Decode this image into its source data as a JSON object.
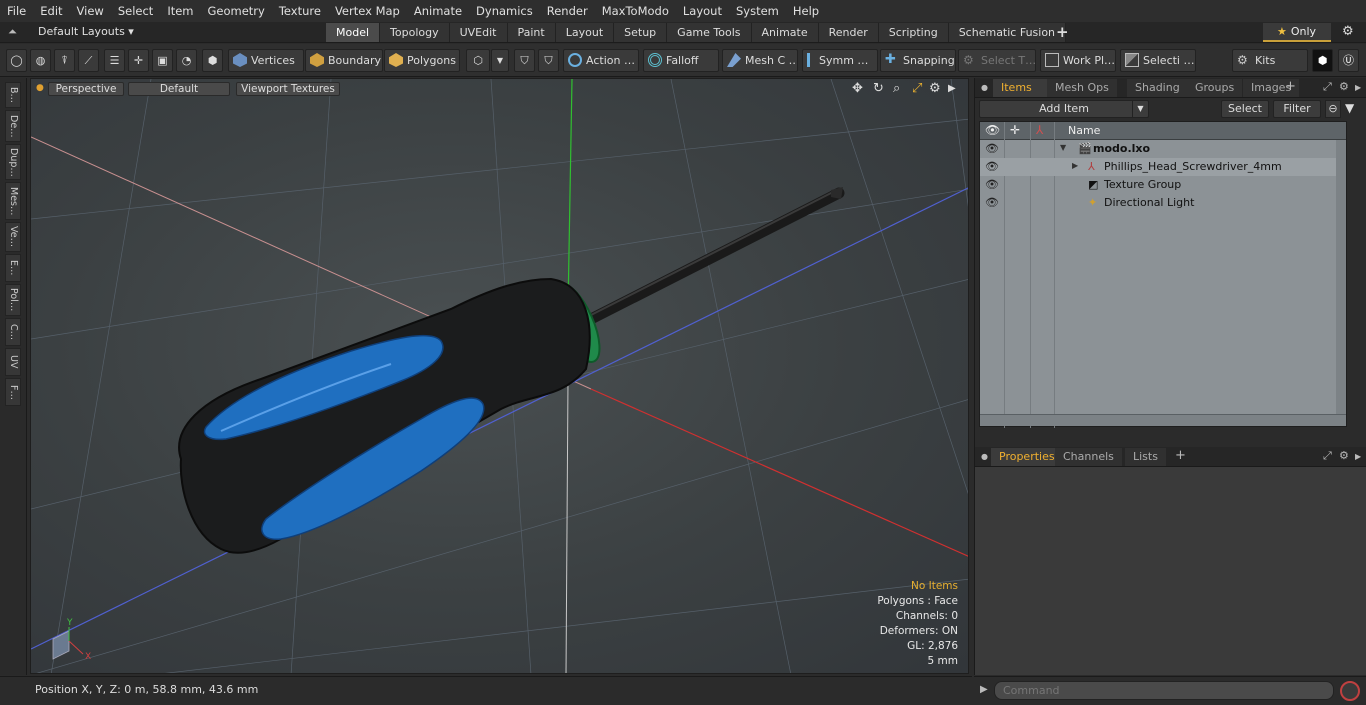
{
  "menu": [
    "File",
    "Edit",
    "View",
    "Select",
    "Item",
    "Geometry",
    "Texture",
    "Vertex Map",
    "Animate",
    "Dynamics",
    "Render",
    "MaxToModo",
    "Layout",
    "System",
    "Help"
  ],
  "layout": {
    "dropdown": "Default Layouts ▾",
    "tabs": [
      "Model",
      "Topology",
      "UVEdit",
      "Paint",
      "Layout",
      "Setup",
      "Game Tools",
      "Animate",
      "Render",
      "Scripting",
      "Schematic Fusion"
    ],
    "active_tab": "Model",
    "only_label": "Only"
  },
  "toolbar": {
    "vertices": "Vertices",
    "boundary": "Boundary",
    "polygons": "Polygons",
    "action": "Action …",
    "falloff": "Falloff",
    "mesh": "Mesh C …",
    "symm": "Symm …",
    "snapping": "Snapping",
    "select_t": "Select T…",
    "work_pl": "Work Pl…",
    "selecti": "Selecti …",
    "kits": "Kits"
  },
  "left_tabs": [
    "B…",
    "De…",
    "Dup…",
    "Mes…",
    "Ve…",
    "E…",
    "Pol…",
    "C…",
    "UV",
    "F…"
  ],
  "viewport": {
    "perspective": "Perspective",
    "default": "Default",
    "viewport_textures": "Viewport Textures",
    "info": {
      "no_items": "No Items",
      "polygons": "Polygons : Face",
      "channels": "Channels: 0",
      "deformers": "Deformers: ON",
      "gl": "GL: 2,876",
      "scale": "5 mm"
    }
  },
  "items_panel": {
    "tabs": [
      "Items",
      "Mesh Ops",
      "Shading",
      "Groups",
      "Images"
    ],
    "active_tab": "Items",
    "add_item": "Add Item",
    "select": "Select",
    "filter": "Filter",
    "name_header": "Name",
    "tree": [
      {
        "label": "modo.lxo",
        "bold": true
      },
      {
        "label": "Phillips_Head_Screwdriver_4mm",
        "bold": false
      },
      {
        "label": "Texture Group",
        "bold": false
      },
      {
        "label": "Directional Light",
        "bold": false
      }
    ]
  },
  "properties_panel": {
    "tabs": [
      "Properties",
      "Channels",
      "Lists"
    ],
    "active_tab": "Properties"
  },
  "status": {
    "position": "Position X, Y, Z:   0 m, 58.8 mm, 43.6 mm"
  },
  "command": {
    "placeholder": "Command"
  },
  "colors": {
    "accent": "#f0b030",
    "handle_blue": "#1f6fc0",
    "ring_green": "#1f8a4a"
  }
}
